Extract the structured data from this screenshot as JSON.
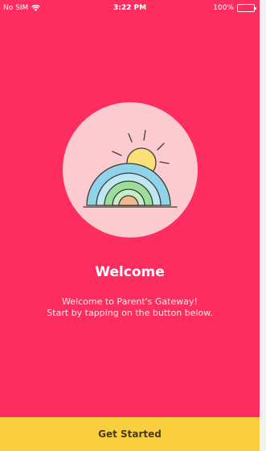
{
  "status_bar": {
    "carrier": "No SIM",
    "time": "3:22 PM",
    "battery": "100%",
    "wifi_icon": "wifi-icon",
    "battery_icon": "battery-icon"
  },
  "illustration": {
    "icon": "rainbow-sun-icon",
    "circle_color": "#fccbd0"
  },
  "welcome": {
    "title": "Welcome",
    "line1": "Welcome to Parent's Gateway!",
    "line2": "Start by tapping on the button below."
  },
  "cta": {
    "label": "Get Started",
    "color": "#f9cf3f"
  },
  "theme": {
    "background": "#fd2e5f"
  }
}
